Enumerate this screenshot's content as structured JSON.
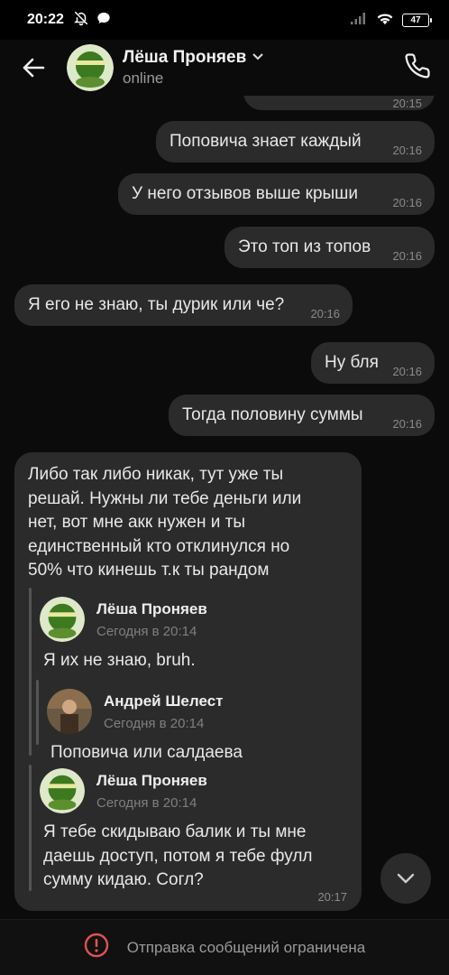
{
  "status_bar": {
    "time": "20:22",
    "battery": "47",
    "icons": [
      "bell-off-icon",
      "chat-bubble-icon",
      "signal-icon",
      "wifi-icon",
      "battery-icon"
    ]
  },
  "header": {
    "name": "Лёша Проняев",
    "status": "online"
  },
  "messages": [
    {
      "text": "",
      "time": "20:15",
      "outgoing": true
    },
    {
      "text": "Поповича знает каждый",
      "time": "20:16",
      "outgoing": true
    },
    {
      "text": "У него отзывов выше крыши",
      "time": "20:16",
      "outgoing": true
    },
    {
      "text": "Это топ из топов",
      "time": "20:16",
      "outgoing": true
    },
    {
      "text": "Я его не знаю, ты дурик или че?",
      "time": "20:16",
      "outgoing": false
    },
    {
      "text": "Ну бля",
      "time": "20:16",
      "outgoing": true
    },
    {
      "text": "Тогда половину суммы",
      "time": "20:16",
      "outgoing": true
    }
  ],
  "long_message": {
    "lines": [
      "Либо так либо никак, тут уже ты",
      "решай. Нужны ли тебе деньги или",
      "нет, вот мне акк нужен и ты",
      "единственный кто отклинулся но",
      "50% что кинешь т.к ты рандом"
    ],
    "time": "20:17",
    "forwarded": [
      {
        "author": "Лёша Проняев",
        "date": "Сегодня в 20:14",
        "text_lines": [
          "Я их не знаю, bruh."
        ],
        "nested": {
          "author": "Андрей Шелест",
          "date": "Сегодня в 20:14",
          "text_lines": [
            "Поповича или салдаева"
          ]
        }
      },
      {
        "author": "Лёша Проняев",
        "date": "Сегодня в 20:14",
        "text_lines": [
          "Я тебе скидываю балик и ты мне",
          "даешь доступ, потом я тебе фулл",
          "сумму кидаю. Согл?"
        ]
      }
    ]
  },
  "bottom_bar": {
    "text": "Отправка сообщений ограничена"
  },
  "colors": {
    "background": "#0b0b0b",
    "bubble": "#2b2b2b",
    "warning": "#e05252"
  }
}
